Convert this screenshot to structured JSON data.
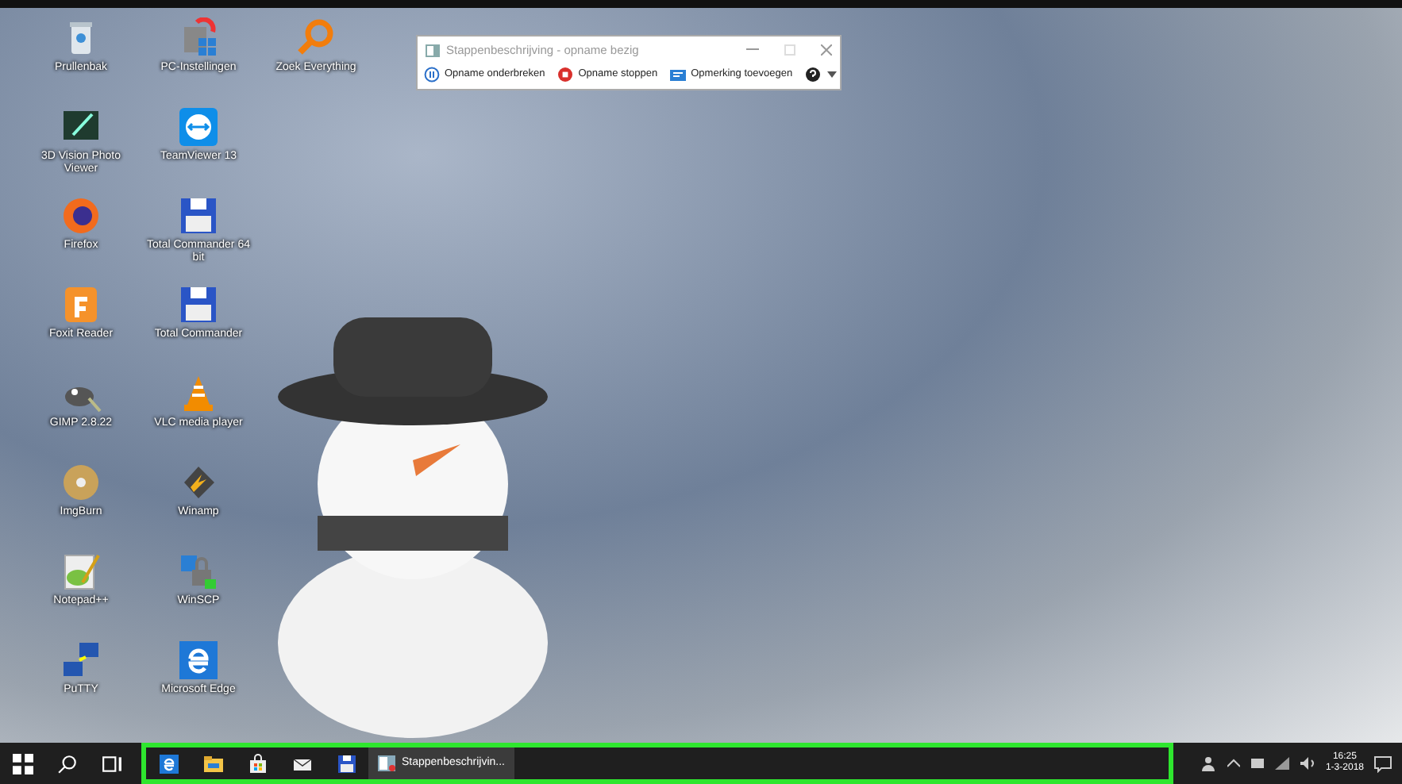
{
  "desktop_icons": [
    {
      "label": "Prullenbak",
      "kind": "recycle"
    },
    {
      "label": "3D Vision Photo Viewer",
      "kind": "viewer"
    },
    {
      "label": "Firefox",
      "kind": "firefox"
    },
    {
      "label": "Foxit Reader",
      "kind": "foxit"
    },
    {
      "label": "GIMP 2.8.22",
      "kind": "gimp"
    },
    {
      "label": "ImgBurn",
      "kind": "disc"
    },
    {
      "label": "Notepad++",
      "kind": "notepad"
    },
    {
      "label": "PuTTY",
      "kind": "putty"
    },
    {
      "label": "PC-Instellingen",
      "kind": "settings"
    },
    {
      "label": "TeamViewer 13",
      "kind": "teamviewer"
    },
    {
      "label": "Total Commander 64 bit",
      "kind": "floppy"
    },
    {
      "label": "Total Commander",
      "kind": "floppy"
    },
    {
      "label": "VLC media player",
      "kind": "vlc"
    },
    {
      "label": "Winamp",
      "kind": "winamp"
    },
    {
      "label": "WinSCP",
      "kind": "winscp"
    },
    {
      "label": "Microsoft Edge",
      "kind": "edge"
    },
    {
      "label": "Zoek Everything",
      "kind": "everything"
    }
  ],
  "steps_recorder": {
    "title": "Stappenbeschrijving - opname bezig",
    "buttons": [
      {
        "label": "Opname onderbreken",
        "kind": "pause"
      },
      {
        "label": "Opname stoppen",
        "kind": "stop"
      },
      {
        "label": "Opmerking toevoegen",
        "kind": "comment"
      }
    ]
  },
  "taskbar": {
    "pinned": [
      {
        "kind": "edge"
      },
      {
        "kind": "explorer"
      },
      {
        "kind": "store"
      },
      {
        "kind": "mail"
      },
      {
        "kind": "floppy"
      }
    ],
    "running": [
      {
        "label": "Stappenbeschrijvin...",
        "selected": true
      }
    ],
    "clock": {
      "time": "16:25",
      "date": "1-3-2018"
    }
  }
}
